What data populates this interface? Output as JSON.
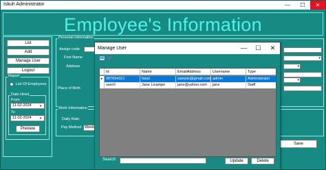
{
  "main_window": {
    "title": "Iskuh Administrator",
    "minimize": "—",
    "maximize": "☐",
    "close": "✕",
    "banner_title": "Employee's Information"
  },
  "left_panel": {
    "buttons": [
      "List",
      "Add",
      "Manage User",
      "Logout"
    ],
    "report": {
      "legend": "Report",
      "list_option": "List Of Employees",
      "date_legend": "Date Hired",
      "from_label": "From",
      "from_value": "11-02-2024",
      "to_label": "To",
      "to_value": "11-02-2024",
      "preview_label": "Preview"
    }
  },
  "personal_info": {
    "legend": "Personal Information",
    "assign_code_label": "Assign code",
    "first_name_label": "First Name",
    "address_label": "Address",
    "place_of_birth_label": "Place of Birth"
  },
  "work_info": {
    "legend": "Work Information",
    "daily_rate_label": "Daily Rate",
    "pay_method_label": "Pay Method",
    "pay_method_value": "Weekly"
  },
  "save_label": "Save",
  "dialog": {
    "title": "Manage User",
    "minimize": "—",
    "maximize": "☐",
    "close": "✕",
    "columns": [
      "Id",
      "Name",
      "EmailAddress",
      "Username",
      "Type"
    ],
    "rows": [
      {
        "id": "987654321",
        "name": "fatuti",
        "email": "sample@gmail.com",
        "username": "admin",
        "type": "Administrator",
        "selected": true
      },
      {
        "id": "user0",
        "name": "Jane Licampo",
        "email": "jane@yahoo.com",
        "username": "jane",
        "type": "Staff",
        "selected": false
      }
    ],
    "search_label": "Search",
    "search_value": "",
    "update_label": "Update",
    "delete_label": "Delete"
  },
  "colors": {
    "background": "#178a84",
    "banner_text": "#4ef3e6",
    "selection": "#0a78d7"
  }
}
